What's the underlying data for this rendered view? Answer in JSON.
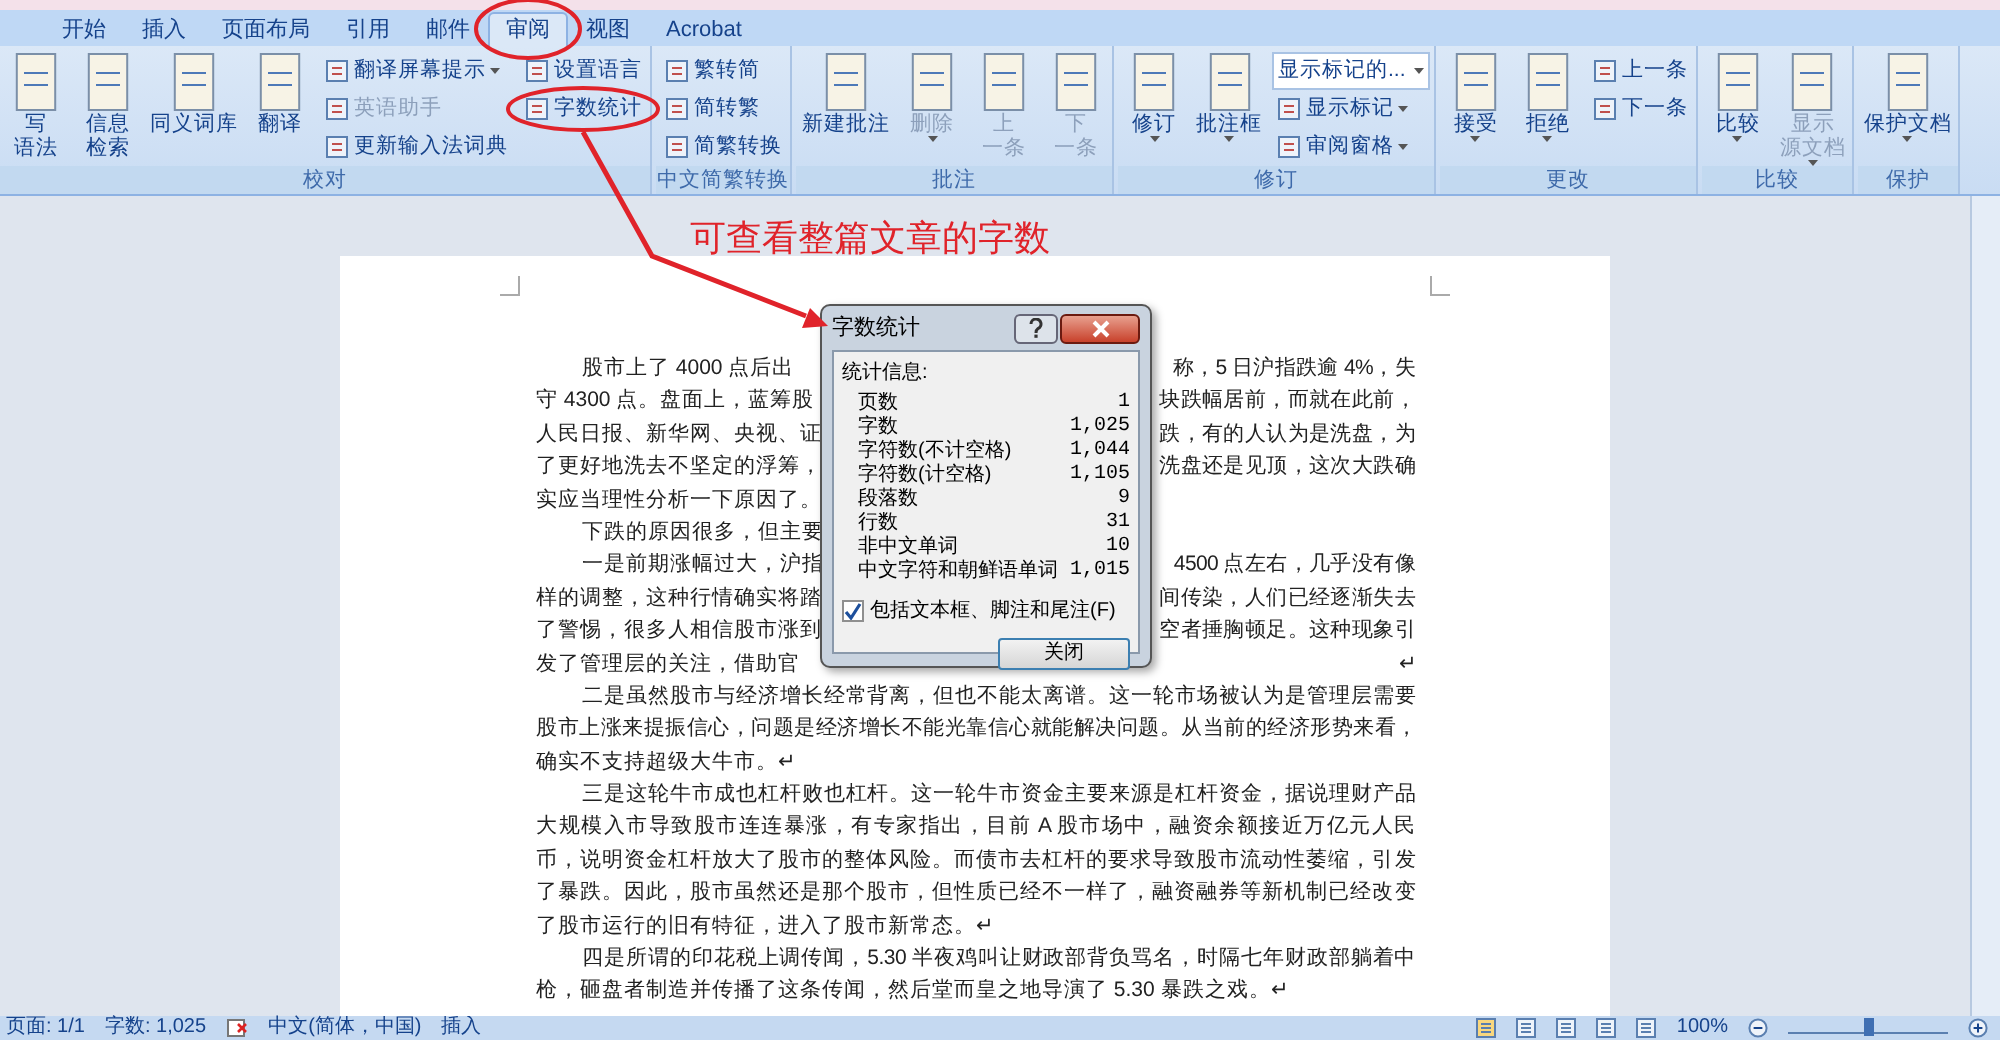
{
  "tabs": [
    {
      "label": "开始",
      "selected": false
    },
    {
      "label": "插入",
      "selected": false
    },
    {
      "label": "页面布局",
      "selected": false
    },
    {
      "label": "引用",
      "selected": false
    },
    {
      "label": "邮件",
      "selected": false
    },
    {
      "label": "审阅",
      "selected": true
    },
    {
      "label": "视图",
      "selected": false
    },
    {
      "label": "Acrobat",
      "selected": false
    }
  ],
  "ribbon_groups": [
    {
      "label": "校对",
      "items": [
        {
          "kind": "large",
          "lines": [
            "写",
            "语法"
          ],
          "dropdown": false,
          "disabled": false
        },
        {
          "kind": "large",
          "lines": [
            "信息",
            "检索"
          ],
          "dropdown": false,
          "disabled": false
        },
        {
          "kind": "large",
          "lines": [
            "同义词库"
          ],
          "dropdown": false,
          "disabled": false
        },
        {
          "kind": "large",
          "lines": [
            "翻译"
          ],
          "dropdown": false,
          "disabled": false
        },
        {
          "kind": "column",
          "items": [
            {
              "kind": "small",
              "label": "翻译屏幕提示",
              "dropdown": true,
              "disabled": false
            },
            {
              "kind": "small",
              "label": "英语助手",
              "dropdown": false,
              "disabled": true
            },
            {
              "kind": "small",
              "label": "更新输入法词典",
              "dropdown": false,
              "disabled": false
            }
          ]
        },
        {
          "kind": "column",
          "items": [
            {
              "kind": "small",
              "label": "设置语言",
              "dropdown": false,
              "disabled": false
            },
            {
              "kind": "small",
              "label": "字数统计",
              "dropdown": false,
              "disabled": false
            }
          ]
        }
      ]
    },
    {
      "label": "中文简繁转换",
      "items": [
        {
          "kind": "column",
          "items": [
            {
              "kind": "small",
              "label": "繁转简",
              "dropdown": false,
              "disabled": false
            },
            {
              "kind": "small",
              "label": "简转繁",
              "dropdown": false,
              "disabled": false
            },
            {
              "kind": "small",
              "label": "简繁转换",
              "dropdown": false,
              "disabled": false
            }
          ]
        }
      ]
    },
    {
      "label": "批注",
      "items": [
        {
          "kind": "large",
          "lines": [
            "新建批注"
          ],
          "dropdown": false,
          "disabled": false
        },
        {
          "kind": "large",
          "lines": [
            "删除"
          ],
          "dropdown": true,
          "disabled": true
        },
        {
          "kind": "large",
          "lines": [
            "上",
            "一条"
          ],
          "dropdown": false,
          "disabled": true
        },
        {
          "kind": "large",
          "lines": [
            "下",
            "一条"
          ],
          "dropdown": false,
          "disabled": true
        }
      ]
    },
    {
      "label": "修订",
      "items": [
        {
          "kind": "large",
          "lines": [
            "修订"
          ],
          "dropdown": true,
          "disabled": false
        },
        {
          "kind": "large",
          "lines": [
            "批注框"
          ],
          "dropdown": true,
          "disabled": false
        },
        {
          "kind": "column",
          "items": [
            {
              "kind": "combo",
              "value": "显示标记的..."
            },
            {
              "kind": "small",
              "label": "显示标记",
              "dropdown": true,
              "disabled": false
            },
            {
              "kind": "small",
              "label": "审阅窗格",
              "dropdown": true,
              "disabled": false
            }
          ]
        }
      ]
    },
    {
      "label": "更改",
      "items": [
        {
          "kind": "large",
          "lines": [
            "接受"
          ],
          "dropdown": true,
          "disabled": false
        },
        {
          "kind": "large",
          "lines": [
            "拒绝"
          ],
          "dropdown": true,
          "disabled": false
        },
        {
          "kind": "column",
          "items": [
            {
              "kind": "small",
              "label": "上一条",
              "dropdown": false,
              "disabled": false
            },
            {
              "kind": "small",
              "label": "下一条",
              "dropdown": false,
              "disabled": false
            }
          ]
        }
      ]
    },
    {
      "label": "比较",
      "items": [
        {
          "kind": "large",
          "lines": [
            "比较"
          ],
          "dropdown": true,
          "disabled": false
        },
        {
          "kind": "large",
          "lines": [
            "显示",
            "源文档"
          ],
          "dropdown": true,
          "disabled": true
        }
      ]
    },
    {
      "label": "保护",
      "items": [
        {
          "kind": "large",
          "lines": [
            "保护文档"
          ],
          "dropdown": true,
          "disabled": false
        }
      ]
    }
  ],
  "annotation": {
    "text": "可查看整篇文章的字数"
  },
  "document": {
    "paragraphs": [
      {
        "lines": [
          {
            "left": "股市上了 4000 点后出",
            "right": "称，5 日沪指跌逾 4%，失"
          },
          {
            "left": "守 4300 点。盘面上，蓝筹股",
            "right": "块跌幅居前，而就在此前，"
          },
          {
            "left": "人民日报、新华网、央视、证",
            "right": "跌，有的人认为是洗盘，为"
          },
          {
            "left": "了更好地洗去不坚定的浮筹，",
            "right": "洗盘还是见顶，这次大跌确"
          },
          {
            "left": "实应当理性分析一下原因了。"
          }
        ]
      },
      {
        "lines": [
          {
            "left": "下跌的原因很多，但主要"
          }
        ]
      },
      {
        "lines": [
          {
            "left": "一是前期涨幅过大，沪指",
            "right": "4500 点左右，几乎没有像"
          },
          {
            "left": "样的调整，这种行情确实将踏",
            "right": "间传染，人们已经逐渐失去"
          },
          {
            "left": "了警惕，很多人相信股市涨到",
            "right": "空者捶胸顿足。这种现象引"
          },
          {
            "left": "发了管理层的关注，借助官",
            "right": "↵"
          }
        ]
      },
      {
        "lines": [
          {
            "text": "二是虽然股市与经济增长经常背离，但也不能太离谱。这一轮市场被认为是管理层需要"
          },
          {
            "text": "股市上涨来提振信心，问题是经济增长不能光靠信心就能解决问题。从当前的经济形势来看，"
          },
          {
            "text": "确实不支持超级大牛市。↵"
          }
        ]
      },
      {
        "lines": [
          {
            "text": "三是这轮牛市成也杠杆败也杠杆。这一轮牛市资金主要来源是杠杆资金，据说理财产品"
          },
          {
            "text": "大规模入市导致股市连连暴涨，有专家指出，目前 A 股市场中，融资余额接近万亿元人民"
          },
          {
            "text": "币，说明资金杠杆放大了股市的整体风险。而债市去杠杆的要求导致股市流动性萎缩，引发"
          },
          {
            "text": "了暴跌。因此，股市虽然还是那个股市，但性质已经不一样了，融资融券等新机制已经改变"
          },
          {
            "text": "了股市运行的旧有特征，进入了股市新常态。↵"
          }
        ]
      },
      {
        "lines": [
          {
            "text": "四是所谓的印花税上调传闻，5.30 半夜鸡叫让财政部背负骂名，时隔七年财政部躺着中"
          },
          {
            "text": "枪，砸盘者制造并传播了这条传闻，然后堂而皇之地导演了 5.30 暴跌之戏。↵"
          }
        ]
      }
    ]
  },
  "dialog": {
    "title": "字数统计",
    "section": "统计信息:",
    "stats": [
      {
        "label": "页数",
        "value": "1"
      },
      {
        "label": "字数",
        "value": "1,025"
      },
      {
        "label": "字符数(不计空格)",
        "value": "1,044"
      },
      {
        "label": "字符数(计空格)",
        "value": "1,105"
      },
      {
        "label": "段落数",
        "value": "9"
      },
      {
        "label": "行数",
        "value": "31"
      },
      {
        "label": "非中文单词",
        "value": "10"
      },
      {
        "label": "中文字符和朝鲜语单词",
        "value": "1,015"
      }
    ],
    "checkbox": {
      "label": "包括文本框、脚注和尾注(F)",
      "checked": true
    },
    "close_button": "关闭"
  },
  "status_bar": {
    "page": "页面: 1/1",
    "words": "字数: 1,025",
    "language": "中文(简体，中国)",
    "mode": "插入",
    "zoom": "100%",
    "zoom_slider": {
      "level": 0.5
    }
  }
}
